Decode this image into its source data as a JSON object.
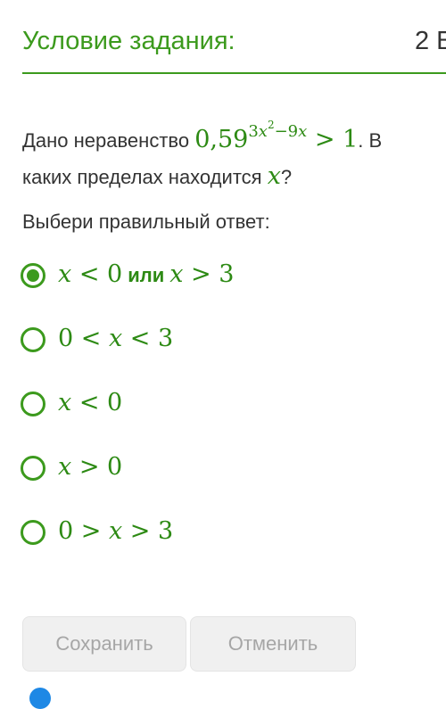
{
  "header": {
    "title": "Условие задания:",
    "points": "2 Б"
  },
  "question": {
    "prefix": "Дано неравенство",
    "base": "0,59",
    "exp_a": "3",
    "exp_var": "x",
    "exp_pow": "2",
    "exp_b": "−9",
    "exp_var2": "x",
    "rhs": " > 1",
    "middle": ". В каких пределах находится",
    "var": "x",
    "suffix": "?"
  },
  "instruction": "Выбери правильный ответ:",
  "options": [
    {
      "left_var": "x",
      "left_op": " < 0",
      "word": "или",
      "right_var": "x",
      "right_op": " > 3",
      "selected": true
    },
    {
      "text": "0 < ",
      "var": "x",
      "text2": " < 3",
      "selected": false
    },
    {
      "var": "x",
      "text2": " < 0",
      "selected": false
    },
    {
      "var": "x",
      "text2": " > 0",
      "selected": false
    },
    {
      "text": "0 > ",
      "var": "x",
      "text2": " > 3",
      "selected": false
    }
  ],
  "buttons": {
    "save": "Сохранить",
    "cancel": "Отменить"
  },
  "colors": {
    "accent": "#3c9a1d",
    "math": "#2d8a14",
    "button_bg": "#f0f0f0",
    "button_text": "#a6a6a6"
  }
}
